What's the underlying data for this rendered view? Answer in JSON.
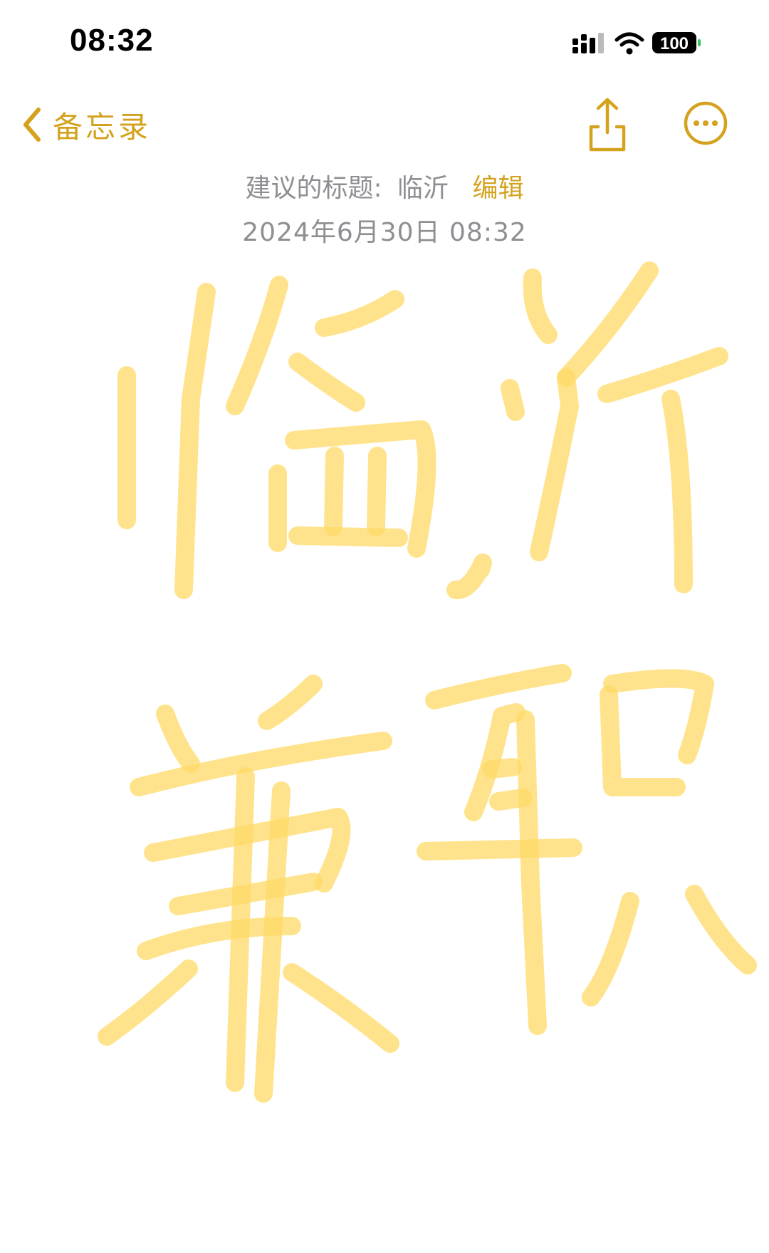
{
  "status_bar": {
    "time": "08:32",
    "battery": "100"
  },
  "nav": {
    "back_label": "备忘录"
  },
  "note": {
    "suggested_title_label": "建议的标题:",
    "suggested_title_value": "临沂",
    "edit_label": "编辑",
    "date": "2024年6月30日 08:32"
  },
  "colors": {
    "accent": "#D4A21E",
    "ink": "#FFD966",
    "secondary_text": "#8e8e93"
  }
}
